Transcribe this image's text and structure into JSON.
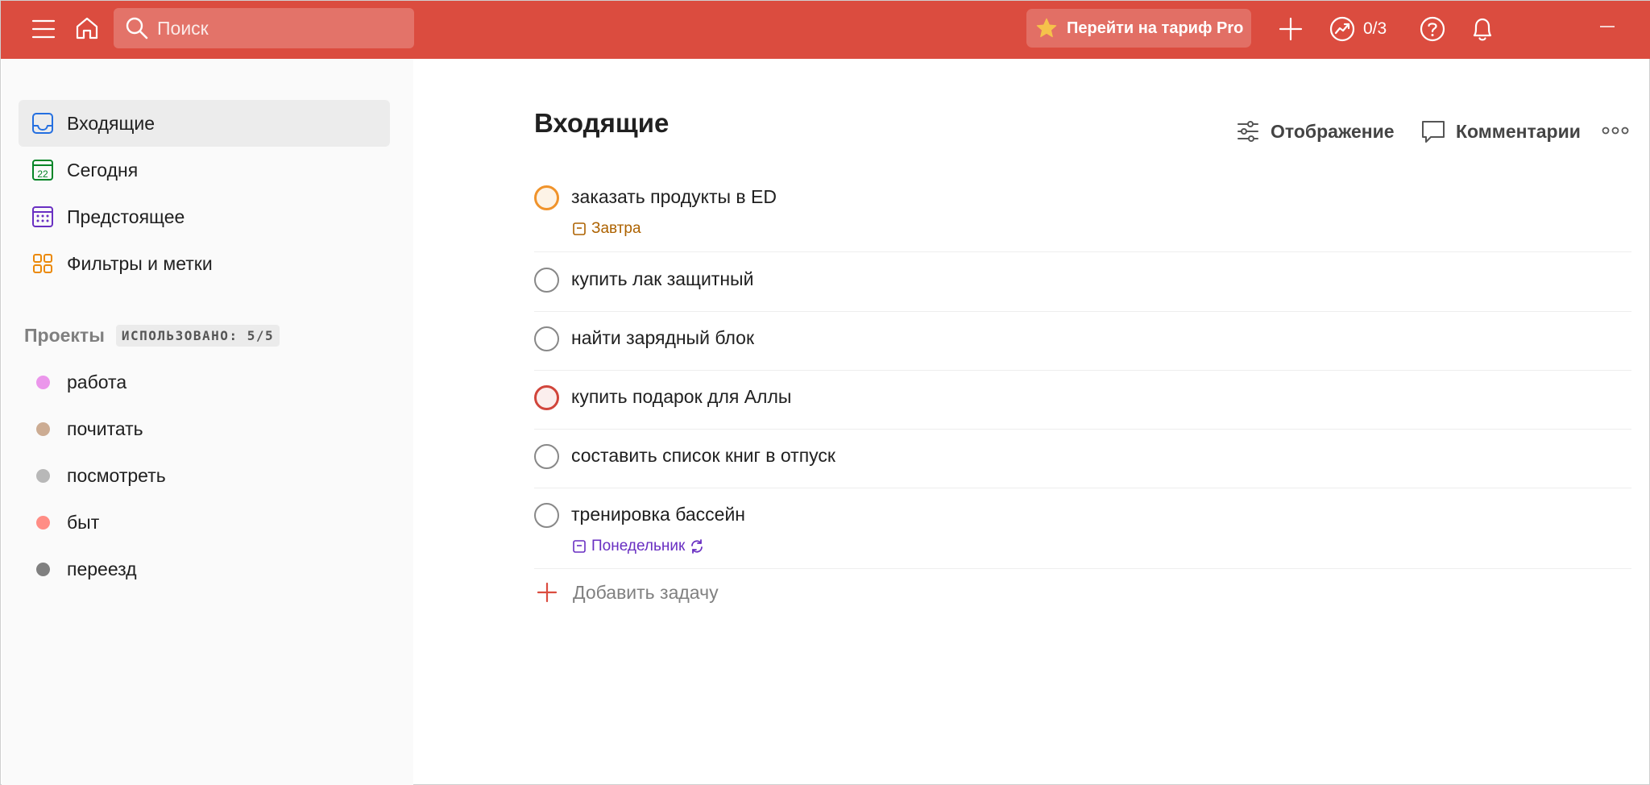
{
  "topbar": {
    "search_placeholder": "Поиск",
    "pro_label": "Перейти на тариф Pro",
    "karma_count": "0/3",
    "bg_color": "#db4c3f"
  },
  "sidebar": {
    "nav": [
      {
        "label": "Входящие",
        "icon": "inbox-icon",
        "active": true
      },
      {
        "label": "Сегодня",
        "icon": "calendar-today-icon",
        "day": "22"
      },
      {
        "label": "Предстоящее",
        "icon": "calendar-upcoming-icon"
      },
      {
        "label": "Фильтры и метки",
        "icon": "filters-icon"
      }
    ],
    "projects_title": "Проекты",
    "projects_badge": "ИСПОЛЬЗОВАНО: 5/5",
    "projects": [
      {
        "label": "работа",
        "color": "#eb96eb"
      },
      {
        "label": "почитать",
        "color": "#ccac93"
      },
      {
        "label": "посмотреть",
        "color": "#b8b8b8"
      },
      {
        "label": "быт",
        "color": "#ff8d85"
      },
      {
        "label": "переезд",
        "color": "#808080"
      }
    ]
  },
  "main": {
    "title": "Входящие",
    "view_label": "Отображение",
    "comments_label": "Комментарии",
    "tasks": [
      {
        "name": "заказать продукты в ED",
        "priority": "p2",
        "due": "Завтра",
        "due_color": "#ad6200"
      },
      {
        "name": "купить лак защитный",
        "priority": "p4"
      },
      {
        "name": "найти зарядный блок",
        "priority": "p4"
      },
      {
        "name": "купить подарок для Аллы",
        "priority": "p1"
      },
      {
        "name": "составить список книг в отпуск",
        "priority": "p4"
      },
      {
        "name": "тренировка бассейн",
        "priority": "p4",
        "due": "Понедельник",
        "due_color": "#692fc2",
        "recurring": true
      }
    ],
    "add_task_label": "Добавить задачу"
  }
}
